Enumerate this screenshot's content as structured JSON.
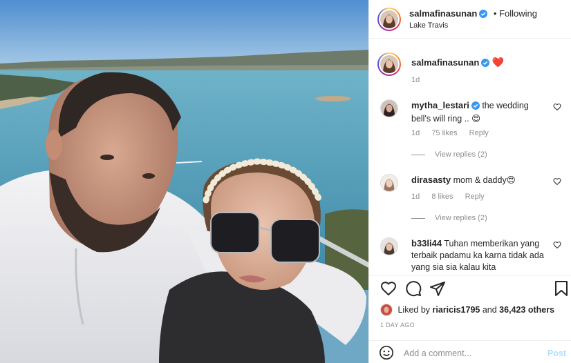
{
  "post": {
    "author": "salmafinasunan",
    "follow_separator": "•",
    "follow_status": "Following",
    "location": "Lake Travis"
  },
  "caption": {
    "author": "salmafinasunan",
    "emoji": "❤️",
    "age": "1d"
  },
  "comments": [
    {
      "author": "mytha_lestari",
      "text": "the wedding bell's will ring .. 😍",
      "age": "1d",
      "likes": "75 likes",
      "reply_label": "Reply",
      "view_replies": "View replies (2)"
    },
    {
      "author": "dirasasty",
      "text": "mom & daddy😍",
      "age": "1d",
      "likes": "8 likes",
      "reply_label": "Reply",
      "view_replies": "View replies (2)"
    },
    {
      "author": "b33li44",
      "text": "Tuhan memberikan yang terbaik padamu ka karna tidak ada yang sia sia kalau kita",
      "age": "",
      "likes": "",
      "reply_label": "",
      "view_replies": ""
    }
  ],
  "likes_line": {
    "prefix": "Liked by",
    "user": "riaricis1795",
    "middle": "and",
    "count": "36,423 others"
  },
  "timestamp": "1 DAY AGO",
  "add_comment": {
    "placeholder": "Add a comment...",
    "post_label": "Post"
  },
  "icons": {
    "verified": "verified-badge-icon",
    "like": "heart-icon",
    "comment": "comment-bubble-icon",
    "share": "paper-plane-icon",
    "save": "bookmark-icon",
    "emoji": "smiley-icon"
  },
  "colors": {
    "verified_blue": "#3897f0",
    "heart_red": "#ed4956",
    "muted_text": "#8e8e8e",
    "post_button_disabled": "#b2dffc"
  }
}
